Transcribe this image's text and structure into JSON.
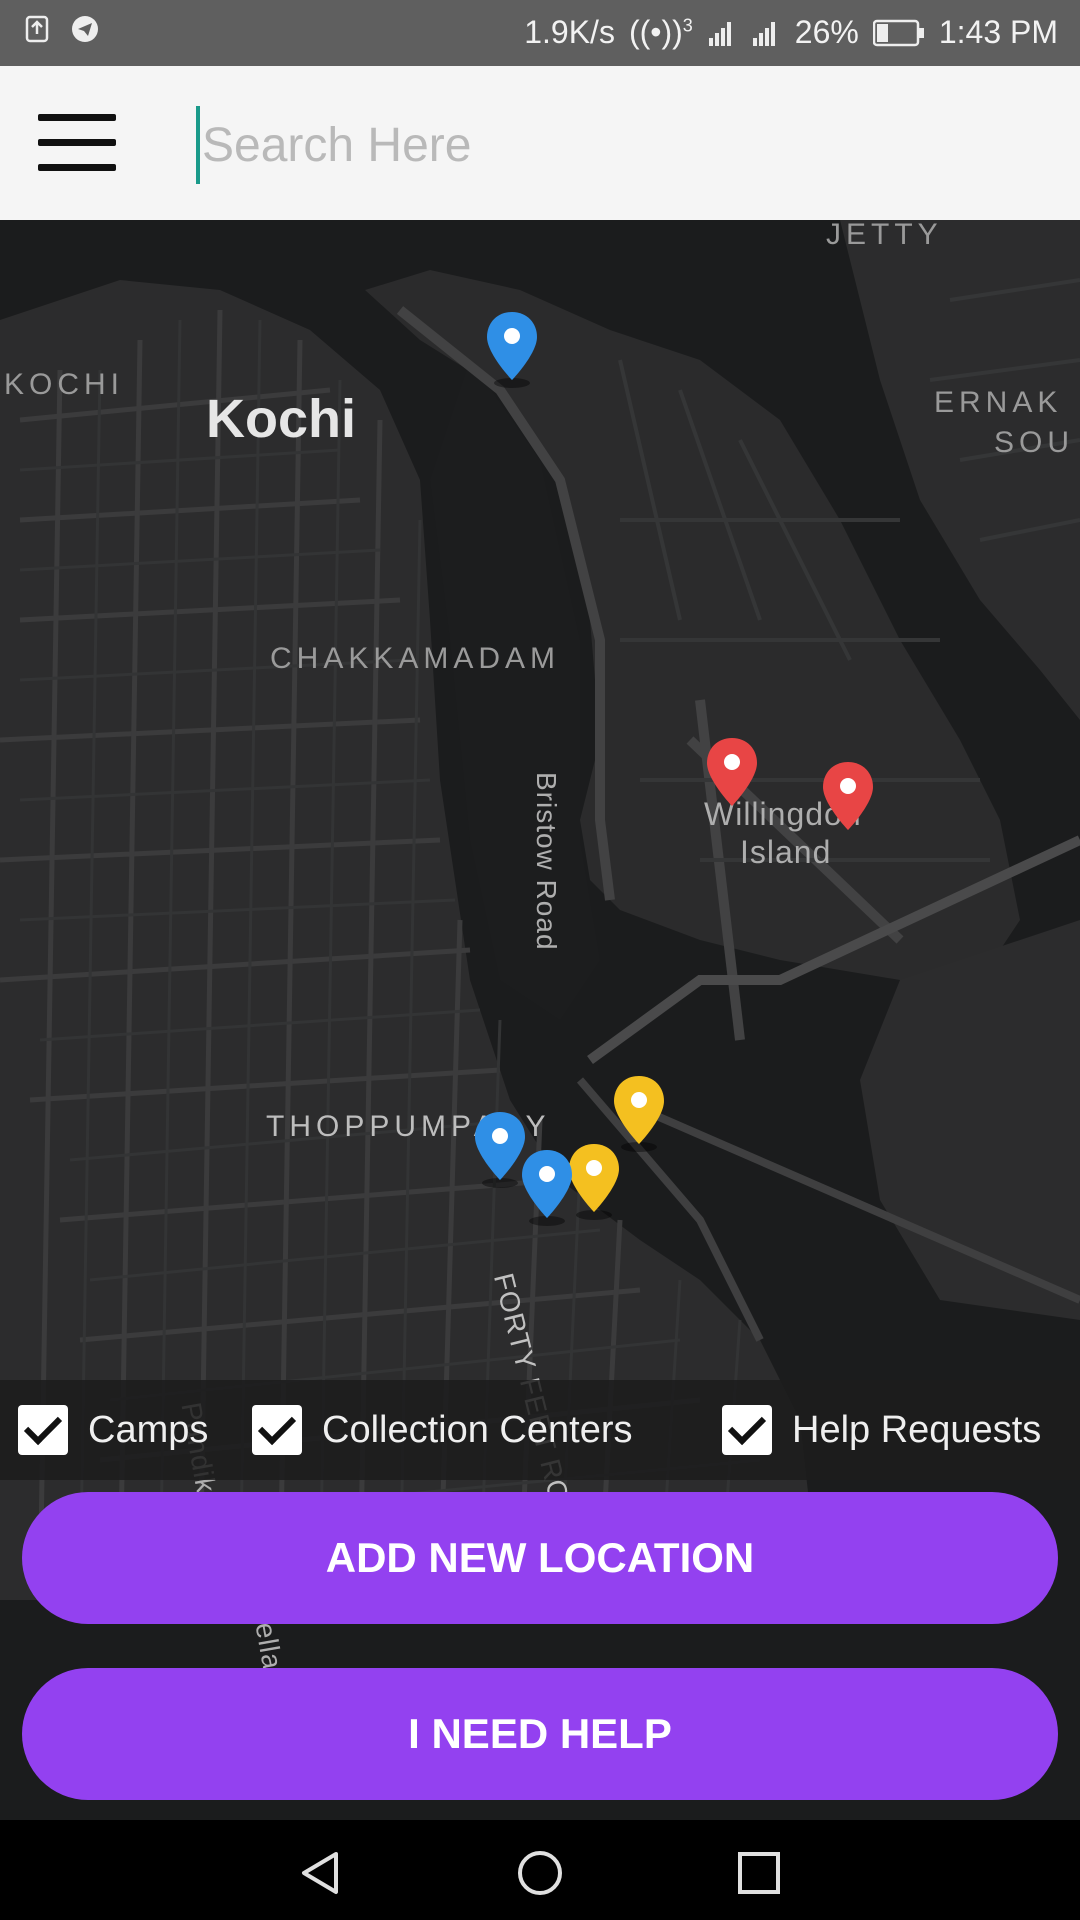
{
  "status_bar": {
    "network_speed": "1.9K/s",
    "hotspot_count": "3",
    "battery": "26%",
    "time": "1:43 PM"
  },
  "search": {
    "placeholder": "Search Here",
    "value": ""
  },
  "map": {
    "labels": {
      "kochi_region": "KOCHI",
      "kochi": "Kochi",
      "jetty": "JETTY",
      "ernakulam_1": "ERNAK",
      "ernakulam_2": "SOU",
      "chakkamadam": "CHAKKAMADAM",
      "bristow_road": "Bristow Road",
      "willingdon": "Willingdon",
      "island": "Island",
      "thoppumpady": "THOPPUMPADY",
      "forty_feet_road": "FORTY FEET RO",
      "pandikudy": "Pandik",
      "bella": "ella"
    },
    "pin_colors": {
      "camp": "#2f8fe6",
      "collection": "#f4c020",
      "help": "#e84545"
    }
  },
  "filters": [
    {
      "label": "Camps",
      "checked": true
    },
    {
      "label": "Collection Centers",
      "checked": true
    },
    {
      "label": "Help Requests",
      "checked": true
    }
  ],
  "buttons": {
    "add_location": "ADD NEW LOCATION",
    "need_help": "I NEED HELP"
  },
  "colors": {
    "accent": "#9341f0",
    "cursor": "#1a9a8a"
  }
}
